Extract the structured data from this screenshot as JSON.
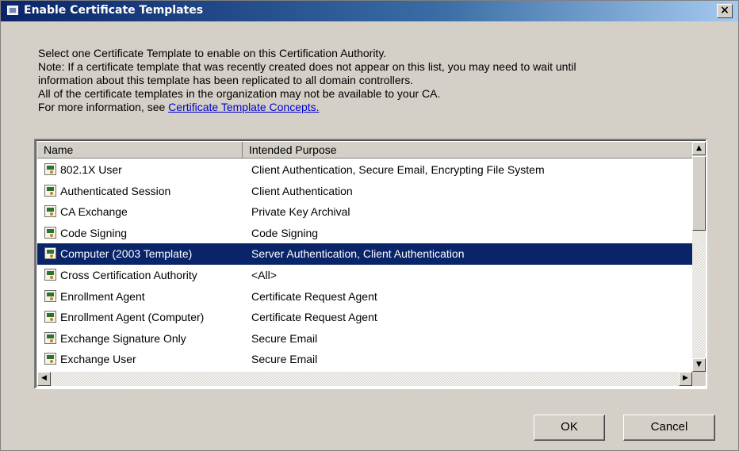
{
  "window": {
    "title": "Enable Certificate Templates",
    "close_label": "×"
  },
  "description": {
    "line1": "Select one Certificate Template to enable on this Certification Authority.",
    "line2": "Note: If a certificate template that was recently created does not appear on this list, you may need to wait until",
    "line3": "information about this template has been replicated to all domain controllers.",
    "line4": "All of the certificate templates in the organization may not be available to your CA.",
    "line5_prefix": "For more information, see ",
    "link_label": "Certificate Template Concepts."
  },
  "list": {
    "columns": [
      "Name",
      "Intended Purpose"
    ],
    "rows": [
      {
        "name": "802.1X User",
        "purpose": "Client Authentication, Secure Email, Encrypting File System"
      },
      {
        "name": "Authenticated Session",
        "purpose": "Client Authentication"
      },
      {
        "name": "CA Exchange",
        "purpose": "Private Key Archival"
      },
      {
        "name": "Code Signing",
        "purpose": "Code Signing"
      },
      {
        "name": "Computer (2003 Template)",
        "purpose": "Server Authentication, Client Authentication"
      },
      {
        "name": "Cross Certification Authority",
        "purpose": "<All>"
      },
      {
        "name": "Enrollment Agent",
        "purpose": "Certificate Request Agent"
      },
      {
        "name": "Enrollment Agent (Computer)",
        "purpose": "Certificate Request Agent"
      },
      {
        "name": "Exchange Signature Only",
        "purpose": "Secure Email"
      },
      {
        "name": "Exchange User",
        "purpose": "Secure Email"
      }
    ],
    "selected_index": 4,
    "row_icon": "certificate-template-icon"
  },
  "buttons": {
    "ok": "OK",
    "cancel": "Cancel"
  },
  "colors": {
    "selection": "#0a246a",
    "titlebar_start": "#0a246a",
    "link": "#0000cc",
    "face": "#d4d0c8"
  }
}
